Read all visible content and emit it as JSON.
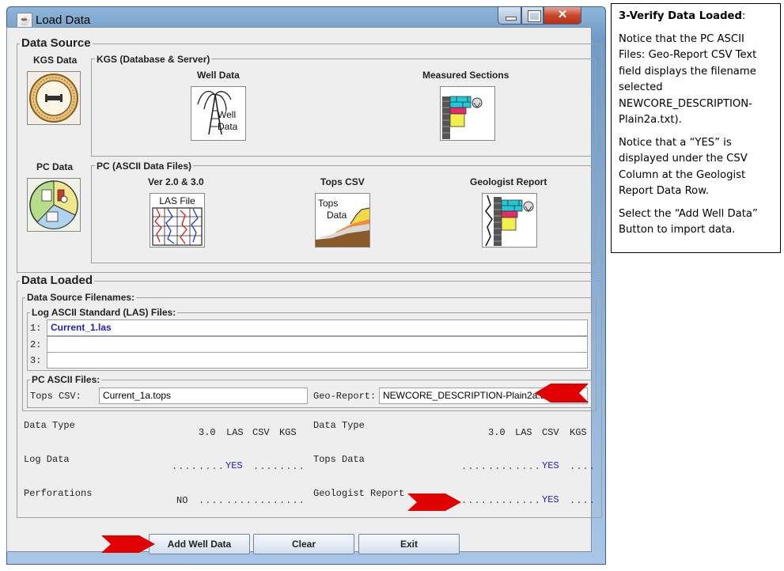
{
  "window": {
    "title": "Load Data"
  },
  "data_source": {
    "title": "Data Source",
    "kgs_data_label": "KGS Data",
    "kgs_group_title": "KGS (Database & Server)",
    "well_data_label": "Well Data",
    "well_icon_text": "Well Data",
    "measured_sections_label": "Measured Sections",
    "pc_data_label": "PC Data",
    "pc_group_title": "PC (ASCII Data Files)",
    "las_label": "Ver 2.0 & 3.0",
    "las_icon_text": "LAS File",
    "tops_label": "Tops CSV",
    "tops_icon_line1": "Tops",
    "tops_icon_line2": "Data",
    "geologist_label": "Geologist Report"
  },
  "data_loaded": {
    "title": "Data Loaded",
    "filenames_title": "Data Source Filenames:",
    "las_group_title": "Log ASCII Standard (LAS) Files:",
    "las_rows": [
      {
        "num": "1:",
        "value": "Current_1.las"
      },
      {
        "num": "2:",
        "value": ""
      },
      {
        "num": "3:",
        "value": ""
      }
    ],
    "pc_files_title": "PC ASCII Files:",
    "tops_csv_label": "Tops CSV:",
    "tops_csv_value": "Current_1a.tops",
    "geo_report_label": "Geo-Report:",
    "geo_report_value": "NEWCORE_DESCRIPTION-Plain2a.txt"
  },
  "status_table": {
    "left": {
      "header": {
        "label": "Data Type",
        "c1": "3.0",
        "c2": "LAS",
        "c3": "CSV",
        "c4": "KGS"
      },
      "rows": [
        {
          "label": "Log Data",
          "c1": "....",
          "c2": "....",
          "c2_yes": "YES",
          "c3": "....",
          "c4": "...."
        },
        {
          "label": "Perforations",
          "c1": "NO",
          "c2": "....",
          "c3": "....",
          "c4": "...."
        }
      ]
    },
    "right": {
      "header": {
        "label": "Data Type",
        "c1": "3.0",
        "c2": "LAS",
        "c3": "CSV",
        "c4": "KGS"
      },
      "rows": [
        {
          "label": "Tops Data",
          "c1": "....",
          "c2": "....",
          "c3": "YES",
          "c4": "...."
        },
        {
          "label": "Geologist Report",
          "c1": "....",
          "c2": "....",
          "c3": "YES",
          "c4": "...."
        }
      ]
    }
  },
  "buttons": {
    "add": "Add Well Data",
    "clear": "Clear",
    "exit": "Exit"
  },
  "instructions": {
    "title": "3-Verify Data Loaded",
    "title_suffix": ":",
    "p1": "Notice that the PC ASCII Files: Geo-Report CSV Text field displays the filename selected NEWCORE_DESCRIPTION-Plain2a.txt).",
    "p2": "Notice that a “YES” is displayed under the CSV Column at the Geologist Report Data Row.",
    "p3": "Select the “Add Well Data” Button to import data."
  },
  "colors": {
    "yes_text": "#2020c8",
    "pointer_arrow": "#e00000",
    "link_text": "#2020c8"
  }
}
